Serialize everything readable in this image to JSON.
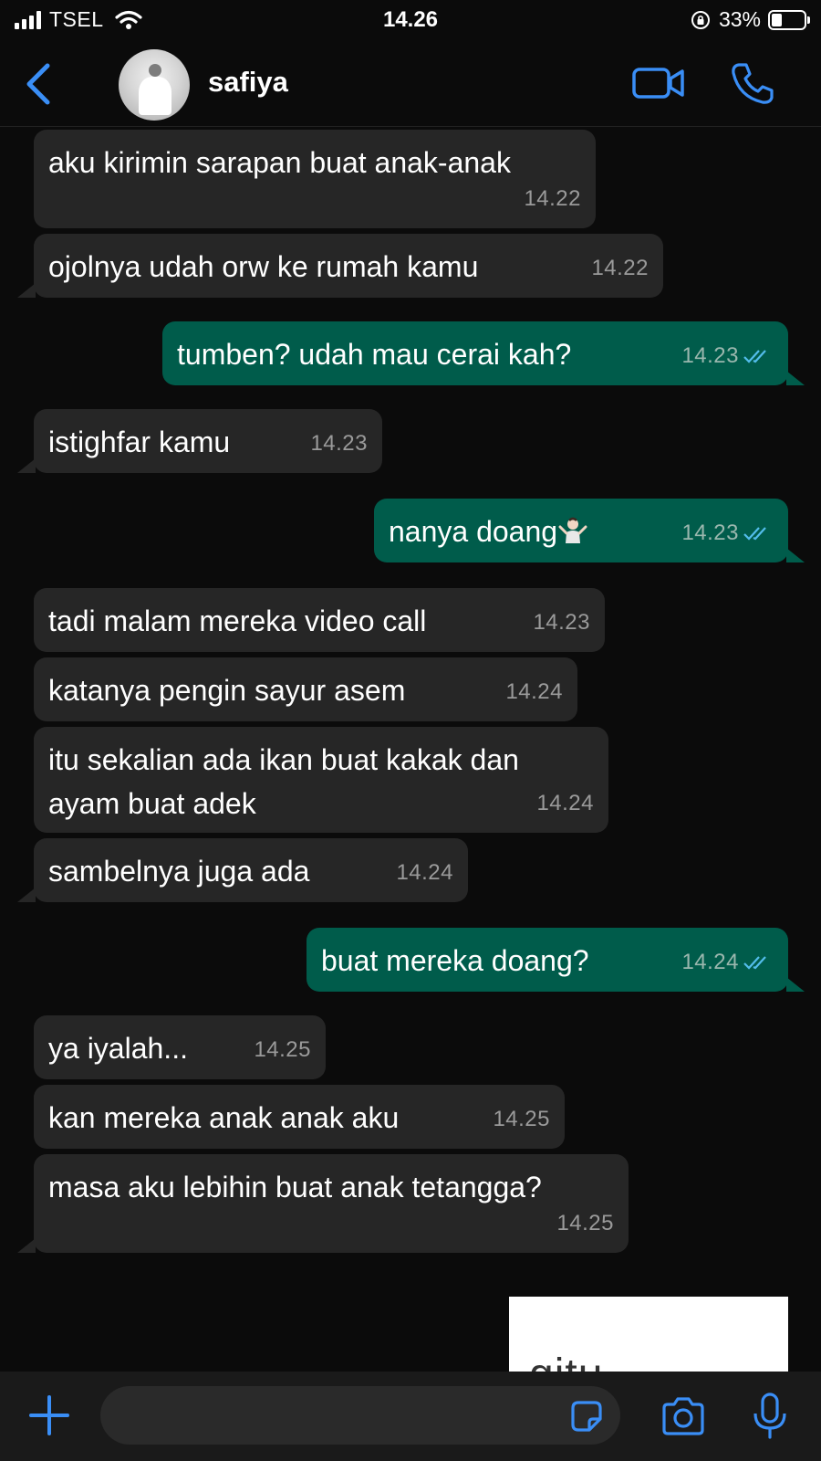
{
  "status_bar": {
    "carrier": "TSEL",
    "time": "14.26",
    "battery": "33%",
    "battery_level": 0.33,
    "icons": [
      "signal-icon",
      "wifi-icon",
      "rotation-lock-icon",
      "battery-icon"
    ]
  },
  "header": {
    "contact_name": "safiya",
    "icons": [
      "chevron-left-icon",
      "video-call-icon",
      "phone-icon"
    ]
  },
  "messages": [
    {
      "dir": "in",
      "text": "aku kirimin sarapan buat anak-anak",
      "time": "14.22"
    },
    {
      "dir": "in",
      "text": "ojolnya udah orw ke rumah kamu",
      "time": "14.22"
    },
    {
      "dir": "out",
      "text": "tumben? udah mau cerai kah?",
      "time": "14.23",
      "read": true
    },
    {
      "dir": "in",
      "text": "istighfar kamu",
      "time": "14.23"
    },
    {
      "dir": "out",
      "text": "nanya doang",
      "emoji": "person-shrugging-emoji",
      "time": "14.23",
      "read": true
    },
    {
      "dir": "in",
      "text": "tadi malam mereka video call",
      "time": "14.23"
    },
    {
      "dir": "in",
      "text": "katanya pengin sayur asem",
      "time": "14.24"
    },
    {
      "dir": "in",
      "text": "itu sekalian ada ikan buat kakak dan\nayam buat adek",
      "time": "14.24"
    },
    {
      "dir": "in",
      "text": "sambelnya juga ada",
      "time": "14.24"
    },
    {
      "dir": "out",
      "text": "buat mereka doang?",
      "time": "14.24",
      "read": true
    },
    {
      "dir": "in",
      "text": "ya iyalah...",
      "time": "14.25"
    },
    {
      "dir": "in",
      "text": "kan mereka anak anak aku",
      "time": "14.25"
    },
    {
      "dir": "in",
      "text": "masa aku lebihin buat anak tetangga?",
      "time": "14.25"
    }
  ],
  "image_message": {
    "text": "gitu"
  },
  "input_bar": {
    "placeholder": "",
    "icons": [
      "plus-icon",
      "sticker-icon",
      "camera-icon",
      "microphone-icon"
    ]
  },
  "colors": {
    "background": "#0b0b0b",
    "incoming_bubble": "#262626",
    "outgoing_bubble": "#005c4b",
    "accent": "#3a8ef6",
    "read_tick": "#53bdeb"
  }
}
